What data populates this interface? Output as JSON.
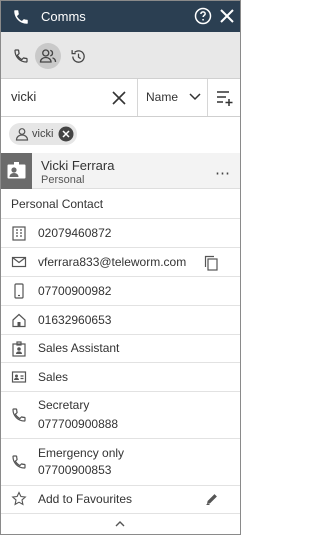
{
  "window": {
    "title": "Comms"
  },
  "modes": [
    {
      "name": "calls-mode",
      "icon": "phone-icon",
      "active": false
    },
    {
      "name": "contacts-mode",
      "icon": "contacts-icon",
      "active": true
    },
    {
      "name": "history-mode",
      "icon": "history-icon",
      "active": false
    }
  ],
  "search": {
    "value": "vicki",
    "sort_field": "Name"
  },
  "filter_chip": {
    "label": "vicki"
  },
  "contact": {
    "name": "Vicki Ferrara",
    "type": "Personal",
    "section_title": "Personal Contact",
    "fields": [
      {
        "icon": "business-phone-icon",
        "value": "02079460872"
      },
      {
        "icon": "email-icon",
        "value": "vferrara833@teleworm.com"
      },
      {
        "icon": "mobile-phone-icon",
        "value": "07700900982"
      },
      {
        "icon": "home-phone-icon",
        "value": "01632960653"
      },
      {
        "icon": "job-title-icon",
        "value": "Sales Assistant"
      },
      {
        "icon": "department-icon",
        "value": "Sales"
      }
    ],
    "labelled_numbers": [
      {
        "label": "Secretary",
        "value": "077700900888"
      },
      {
        "label": "Emergency only",
        "value": "07700900853"
      }
    ],
    "favourite_label": "Add to Favourites"
  },
  "colors": {
    "titlebar": "#2b3f52",
    "avatar": "#6b6b6b",
    "modebar": "#e8e8e8"
  }
}
